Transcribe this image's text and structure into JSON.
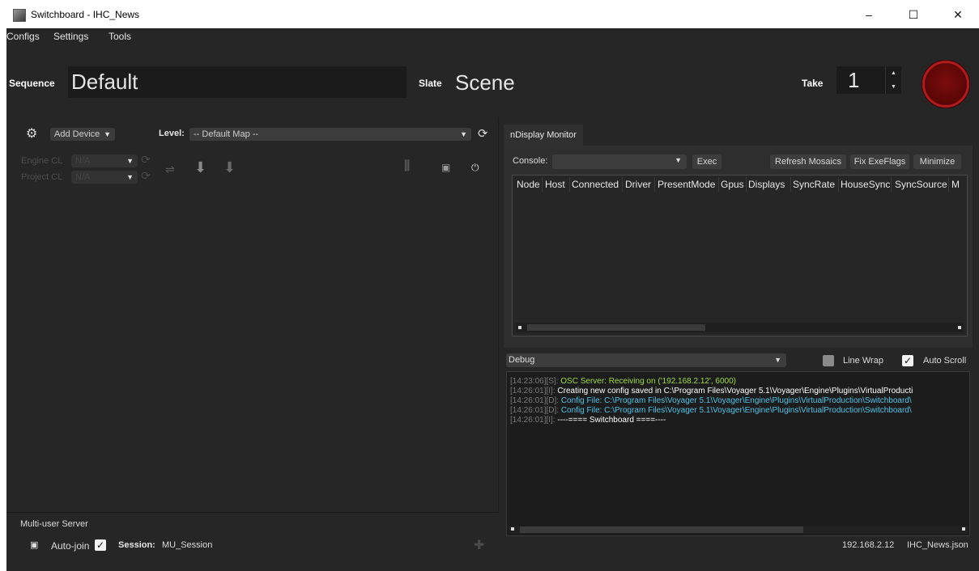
{
  "window": {
    "title": "Switchboard - IHC_News",
    "minimize": "–",
    "maximize": "☐",
    "close": "✕"
  },
  "menu": {
    "items": [
      "Configs",
      "Settings",
      "Tools"
    ]
  },
  "header": {
    "sequence_label": "Sequence",
    "sequence_value": "Default",
    "slate_label": "Slate",
    "slate_value": "Scene",
    "take_label": "Take",
    "take_value": "1"
  },
  "devices": {
    "add_device": "Add Device",
    "level_label": "Level:",
    "level_value": "-- Default Map --",
    "engine_cl_label": "Engine CL",
    "project_cl_label": "Project CL",
    "engine_cl_value": "N/A",
    "project_cl_value": "N/A"
  },
  "multi_user": {
    "title": "Multi-user Server",
    "auto_join_label": "Auto-join",
    "auto_join_checked": true,
    "session_label": "Session:",
    "session_value": "MU_Session"
  },
  "ndisplay": {
    "tab_label": "nDisplay Monitor",
    "console_label": "Console:",
    "exec_button": "Exec",
    "refresh_mosaics_button": "Refresh Mosaics",
    "fix_exeflags_button": "Fix ExeFlags",
    "minimize_button": "Minimize",
    "columns": [
      "Node",
      "Host",
      "Connected",
      "Driver",
      "PresentMode",
      "Gpus",
      "Displays",
      "SyncRate",
      "HouseSync",
      "SyncSource",
      "M"
    ]
  },
  "log": {
    "level": "Debug",
    "line_wrap_label": "Line Wrap",
    "line_wrap_checked": false,
    "auto_scroll_label": "Auto Scroll",
    "auto_scroll_checked": true,
    "lines": [
      {
        "prefix": "[14:23:06][S]:",
        "text": "OSC Server: Receiving on ('192.168.2.12', 6000)",
        "color": "#9fdc3c"
      },
      {
        "prefix": "[14:26:01][I]:",
        "text": "Creating new config saved in C:\\Program Files\\Voyager 5.1\\Voyager\\Engine\\Plugins\\VirtualProducti",
        "color": "#ffffff"
      },
      {
        "prefix": "[14:26:01][D]:",
        "text": "Config File: C:\\Program Files\\Voyager 5.1\\Voyager\\Engine\\Plugins\\VirtualProduction\\Switchboard\\",
        "color": "#4fc3e8"
      },
      {
        "prefix": "[14:26:01][D]:",
        "text": "Config File: C:\\Program Files\\Voyager 5.1\\Voyager\\Engine\\Plugins\\VirtualProduction\\Switchboard\\",
        "color": "#4fc3e8"
      },
      {
        "prefix": "[14:26:01][I]:",
        "text": "----==== Switchboard ====----",
        "color": "#ffffff"
      }
    ]
  },
  "status": {
    "ip": "192.168.2.12",
    "config_file": "IHC_News.json"
  },
  "colors": {
    "background": "#262626",
    "record": "#7c0d0d",
    "log_green": "#9fdc3c",
    "log_cyan": "#4fc3e8"
  },
  "icons": [
    "settings-gear-icon",
    "refresh-icon",
    "swap-icon",
    "sync-icon",
    "build-icon",
    "mixer-icon",
    "terminal-icon",
    "plug-icon",
    "plus-icon"
  ]
}
